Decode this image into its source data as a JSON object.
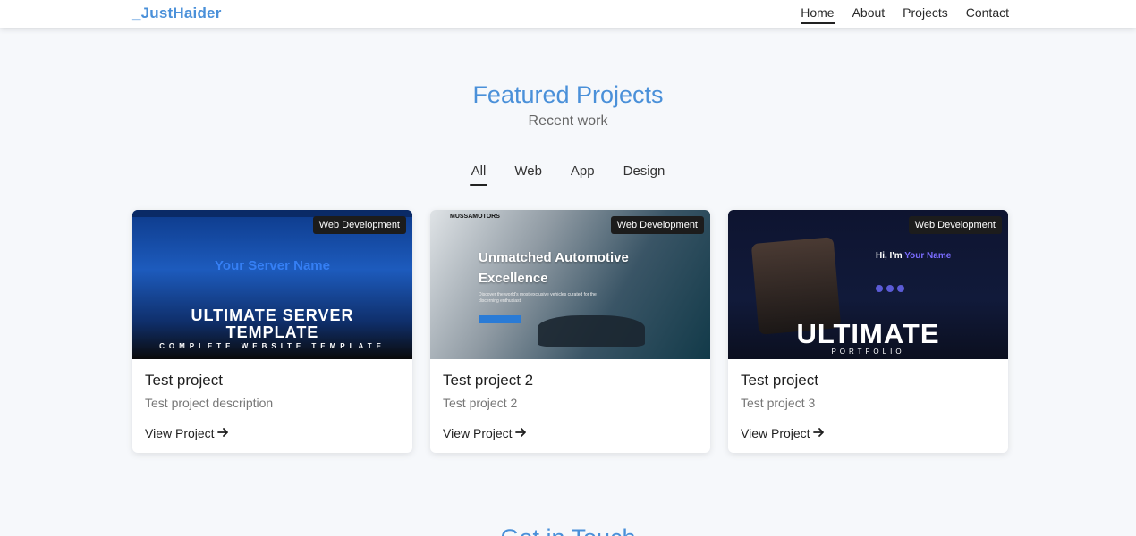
{
  "nav": {
    "brand": "_JustHaider",
    "links": [
      "Home",
      "About",
      "Projects",
      "Contact"
    ],
    "active": "Home"
  },
  "projects_section": {
    "title": "Featured Projects",
    "subtitle": "Recent work",
    "filters": [
      "All",
      "Web",
      "App",
      "Design"
    ],
    "active_filter": "All",
    "cards": [
      {
        "badge": "Web Development",
        "title": "Test project",
        "description": "Test project description",
        "link": "View Project",
        "thumb": {
          "glow": "Your Server Name",
          "line1": "ULTIMATE SERVER",
          "line2": "TEMPLATE",
          "line3": "COMPLETE WEBSITE TEMPLATE"
        }
      },
      {
        "badge": "Web Development",
        "title": "Test project 2",
        "description": "Test project 2",
        "link": "View Project",
        "thumb": {
          "brand": "MUSSAMOTORS",
          "headline1": "Unmatched Automotive",
          "headline2": "Excellence",
          "sub": "Discover the world's most exclusive vehicles curated for the discerning enthusiast"
        }
      },
      {
        "badge": "Web Development",
        "title": "Test project",
        "description": "Test project 3",
        "link": "View Project",
        "thumb": {
          "hi": "Hi, I'm",
          "name": "Your Name",
          "big": "ULTIMATE",
          "small": "PORTFOLIO"
        }
      }
    ]
  },
  "next_section": {
    "title": "Get in Touch"
  }
}
